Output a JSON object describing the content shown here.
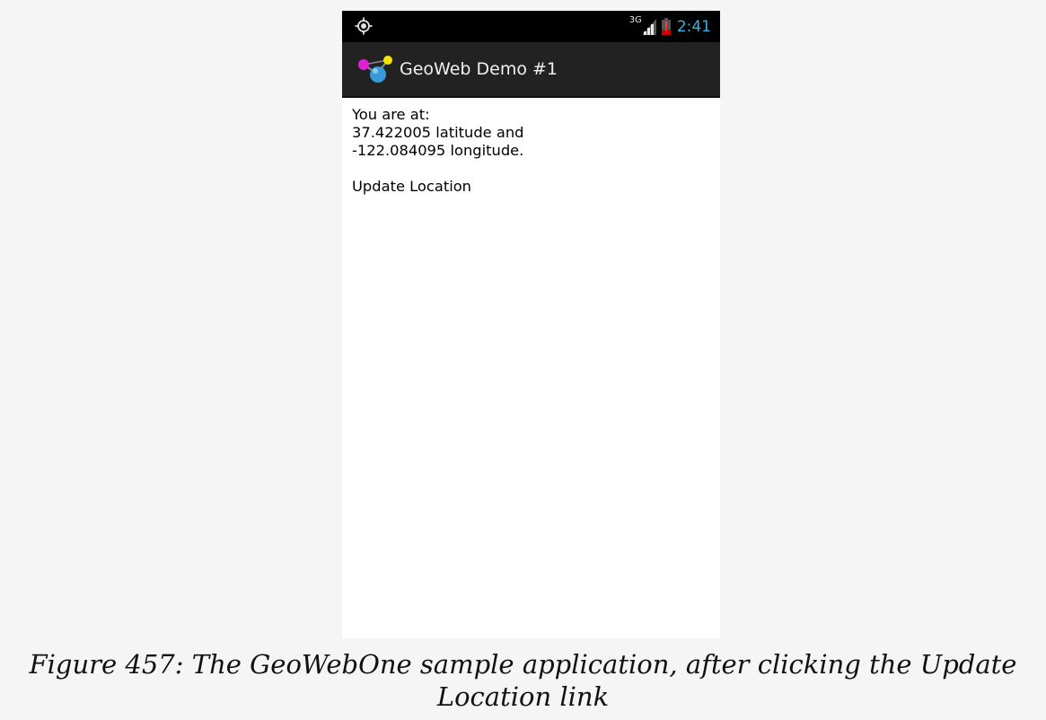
{
  "status_bar": {
    "location_icon": "gps-target-icon",
    "network_type": "3G",
    "signal_icon": "cell-signal-icon",
    "battery_icon": "battery-low-icon",
    "time": "2:41",
    "clock_color": "#33b5e5",
    "battery_alert_color": "#cc0000"
  },
  "action_bar": {
    "app_icon": "geoweb-app-icon",
    "title": "GeoWeb Demo #1"
  },
  "content": {
    "line1": "You are at:",
    "line2": "37.422005 latitude and",
    "line3": "-122.084095 longitude.",
    "link_label": "Update Location"
  },
  "caption": {
    "text": "Figure 457: The GeoWebOne sample application, after clicking the Update Location link"
  }
}
